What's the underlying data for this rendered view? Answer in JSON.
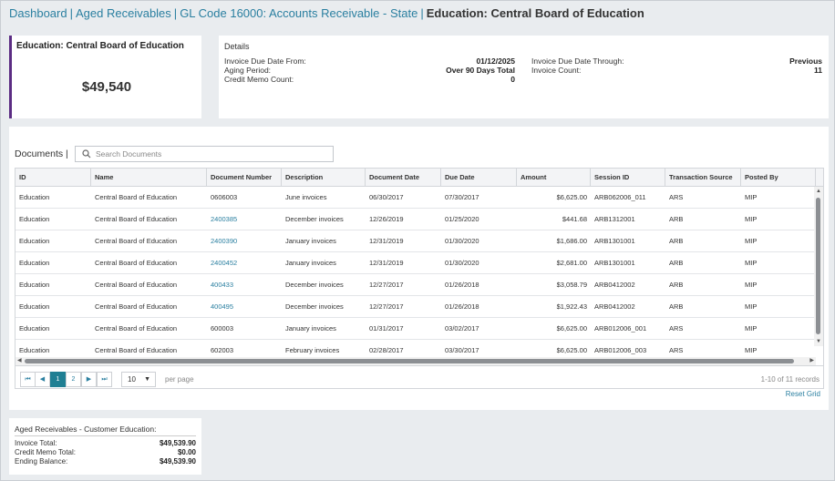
{
  "breadcrumb": {
    "items": [
      "Dashboard",
      "Aged Receivables",
      "GL Code 16000: Accounts Receivable - State"
    ],
    "separator": "|",
    "current": "Education: Central Board of Education"
  },
  "summary": {
    "title": "Education: Central Board of Education",
    "amount": "$49,540",
    "accent_color": "#5b2c83"
  },
  "details": {
    "title": "Details",
    "left": [
      {
        "label": "Invoice Due Date From:",
        "value": "01/12/2025"
      },
      {
        "label": "Aging Period:",
        "value": "Over 90 Days Total"
      },
      {
        "label": "Credit Memo Count:",
        "value": "0"
      }
    ],
    "right": [
      {
        "label": "Invoice Due Date Through:",
        "value": "Previous"
      },
      {
        "label": "Invoice Count:",
        "value": "11"
      }
    ]
  },
  "documents": {
    "header": "Documents |",
    "search_placeholder": "Search Documents",
    "search_icon": "search-icon",
    "columns": [
      "ID",
      "Name",
      "Document Number",
      "Description",
      "Document Date",
      "Due Date",
      "Amount",
      "Session ID",
      "Transaction Source",
      "Posted By"
    ],
    "rows": [
      {
        "id": "Education",
        "name": "Central Board of Education",
        "doc": "0606003",
        "doc_link": false,
        "desc": "June invoices",
        "doc_date": "06/30/2017",
        "due": "07/30/2017",
        "amount": "$6,625.00",
        "session": "ARB062006_011",
        "source": "ARS",
        "posted": "MIP"
      },
      {
        "id": "Education",
        "name": "Central Board of Education",
        "doc": "2400385",
        "doc_link": true,
        "desc": "December invoices",
        "doc_date": "12/26/2019",
        "due": "01/25/2020",
        "amount": "$441.68",
        "session": "ARB1312001",
        "source": "ARB",
        "posted": "MIP"
      },
      {
        "id": "Education",
        "name": "Central Board of Education",
        "doc": "2400390",
        "doc_link": true,
        "desc": "January invoices",
        "doc_date": "12/31/2019",
        "due": "01/30/2020",
        "amount": "$1,686.00",
        "session": "ARB1301001",
        "source": "ARB",
        "posted": "MIP"
      },
      {
        "id": "Education",
        "name": "Central Board of Education",
        "doc": "2400452",
        "doc_link": true,
        "desc": "January invoices",
        "doc_date": "12/31/2019",
        "due": "01/30/2020",
        "amount": "$2,681.00",
        "session": "ARB1301001",
        "source": "ARB",
        "posted": "MIP"
      },
      {
        "id": "Education",
        "name": "Central Board of Education",
        "doc": "400433",
        "doc_link": true,
        "desc": "December invoices",
        "doc_date": "12/27/2017",
        "due": "01/26/2018",
        "amount": "$3,058.79",
        "session": "ARB0412002",
        "source": "ARB",
        "posted": "MIP"
      },
      {
        "id": "Education",
        "name": "Central Board of Education",
        "doc": "400495",
        "doc_link": true,
        "desc": "December invoices",
        "doc_date": "12/27/2017",
        "due": "01/26/2018",
        "amount": "$1,922.43",
        "session": "ARB0412002",
        "source": "ARB",
        "posted": "MIP"
      },
      {
        "id": "Education",
        "name": "Central Board of Education",
        "doc": "600003",
        "doc_link": false,
        "desc": "January invoices",
        "doc_date": "01/31/2017",
        "due": "03/02/2017",
        "amount": "$6,625.00",
        "session": "ARB012006_001",
        "source": "ARS",
        "posted": "MIP"
      },
      {
        "id": "Education",
        "name": "Central Board of Education",
        "doc": "602003",
        "doc_link": false,
        "desc": "February invoices",
        "doc_date": "02/28/2017",
        "due": "03/30/2017",
        "amount": "$6,625.00",
        "session": "ARB012006_003",
        "source": "ARS",
        "posted": "MIP"
      }
    ],
    "pager": {
      "first": "⏮",
      "prev": "◀",
      "pages": [
        "1",
        "2"
      ],
      "active_page": "1",
      "next": "▶",
      "last": "⏭",
      "page_size": "10",
      "per_page_label": "per page",
      "records": "1-10 of 11 records"
    },
    "reset_label": "Reset Grid"
  },
  "aged": {
    "title": "Aged Receivables - Customer Education:",
    "rows": [
      {
        "label": "Invoice Total:",
        "value": "$49,539.90"
      },
      {
        "label": "Credit Memo Total:",
        "value": "$0.00"
      },
      {
        "label": "Ending Balance:",
        "value": "$49,539.90"
      }
    ]
  },
  "colors": {
    "link": "#2a7fa0",
    "accent": "#5b2c83",
    "active_page": "#1f7f93",
    "background": "#e9ecef"
  }
}
